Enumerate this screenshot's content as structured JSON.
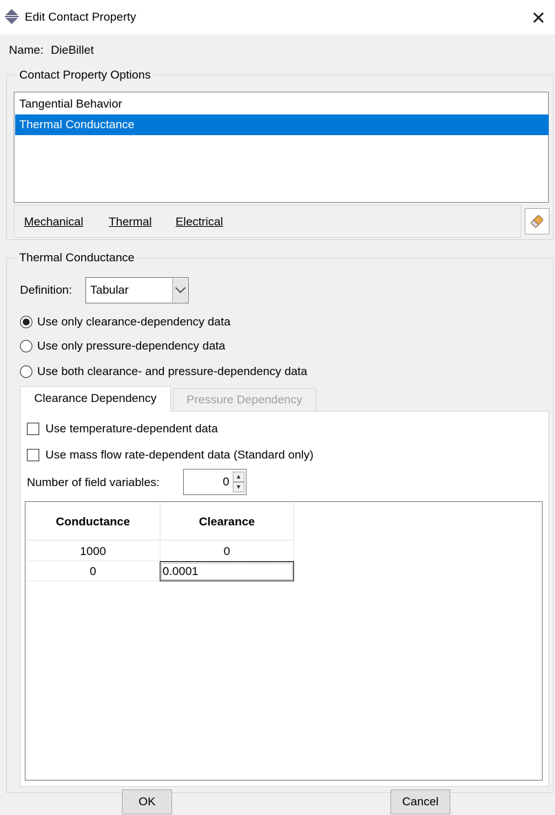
{
  "window": {
    "title": "Edit Contact Property",
    "close_glyph": "✕"
  },
  "name": {
    "label": "Name:",
    "value": "DieBillet"
  },
  "options_group": {
    "title": "Contact Property Options",
    "items": [
      {
        "label": "Tangential Behavior",
        "selected": false
      },
      {
        "label": "Thermal Conductance",
        "selected": true
      }
    ],
    "menus": [
      {
        "label": "Mechanical"
      },
      {
        "label": "Thermal"
      },
      {
        "label": "Electrical"
      }
    ],
    "eraser_icon": "eraser-icon"
  },
  "thermal_group": {
    "title": "Thermal Conductance",
    "definition_label": "Definition:",
    "definition_value": "Tabular",
    "radios": [
      {
        "label": "Use only clearance-dependency data",
        "checked": true
      },
      {
        "label": "Use only pressure-dependency data",
        "checked": false
      },
      {
        "label": "Use both clearance- and pressure-dependency data",
        "checked": false
      }
    ],
    "tabs": [
      {
        "label": "Clearance Dependency",
        "active": true
      },
      {
        "label": "Pressure Dependency",
        "active": false
      }
    ],
    "checkboxes": [
      {
        "label": "Use temperature-dependent data",
        "checked": false
      },
      {
        "label": "Use mass flow rate-dependent data (Standard only)",
        "checked": false
      }
    ],
    "field_vars_label": "Number of field variables:",
    "field_vars_value": "0",
    "table": {
      "headers": [
        "Conductance",
        "Clearance"
      ],
      "rows": [
        [
          "1000",
          "0"
        ],
        [
          "0",
          "0.0001"
        ]
      ]
    }
  },
  "buttons": {
    "ok": "OK",
    "cancel": "Cancel"
  },
  "colors": {
    "selection": "#0078d7",
    "dialog_bg": "#f0f0f0"
  }
}
